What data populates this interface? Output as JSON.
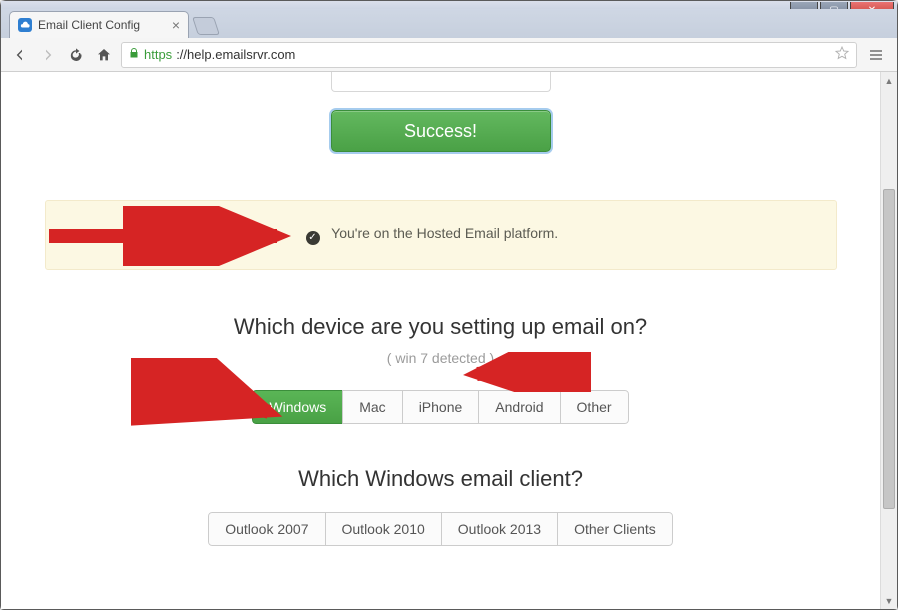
{
  "browser": {
    "tab_title": "Email Client Config",
    "url_scheme": "https",
    "url_rest": "://help.emailsrvr.com"
  },
  "page": {
    "success_label": "Success!",
    "alert_message": "You're on the Hosted Email platform.",
    "device_heading": "Which device are you setting up email on?",
    "detected_note": "( win 7 detected )",
    "device_options": [
      "Windows",
      "Mac",
      "iPhone",
      "Android",
      "Other"
    ],
    "device_active_index": 0,
    "client_heading": "Which Windows email client?",
    "client_options": [
      "Outlook 2007",
      "Outlook 2010",
      "Outlook 2013",
      "Other Clients"
    ]
  }
}
